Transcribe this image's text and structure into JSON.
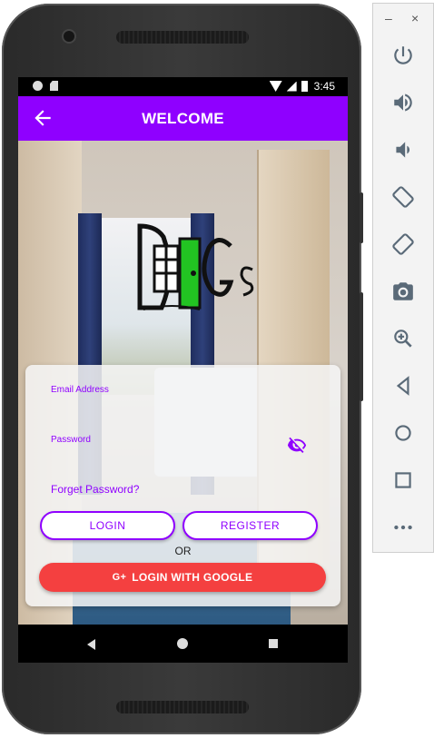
{
  "status_bar": {
    "time": "3:45"
  },
  "app_bar": {
    "title": "WELCOME"
  },
  "login": {
    "email_label": "Email Address",
    "password_label": "Password",
    "forgot_password": "Forget Password?",
    "login_button": "LOGIN",
    "register_button": "REGISTER",
    "or_text": "OR",
    "google_button": "LOGIN WITH GOOGLE",
    "google_icon_text": "G+"
  },
  "colors": {
    "accent": "#8f00ff",
    "google_red": "#f44040"
  },
  "emulator_toolbar": {
    "minimize": "–",
    "close": "×",
    "icons": [
      "power-icon",
      "volume-up-icon",
      "volume-down-icon",
      "rotate-left-icon",
      "rotate-right-icon",
      "camera-icon",
      "zoom-icon",
      "back-icon",
      "home-icon",
      "overview-icon",
      "more-icon"
    ]
  }
}
